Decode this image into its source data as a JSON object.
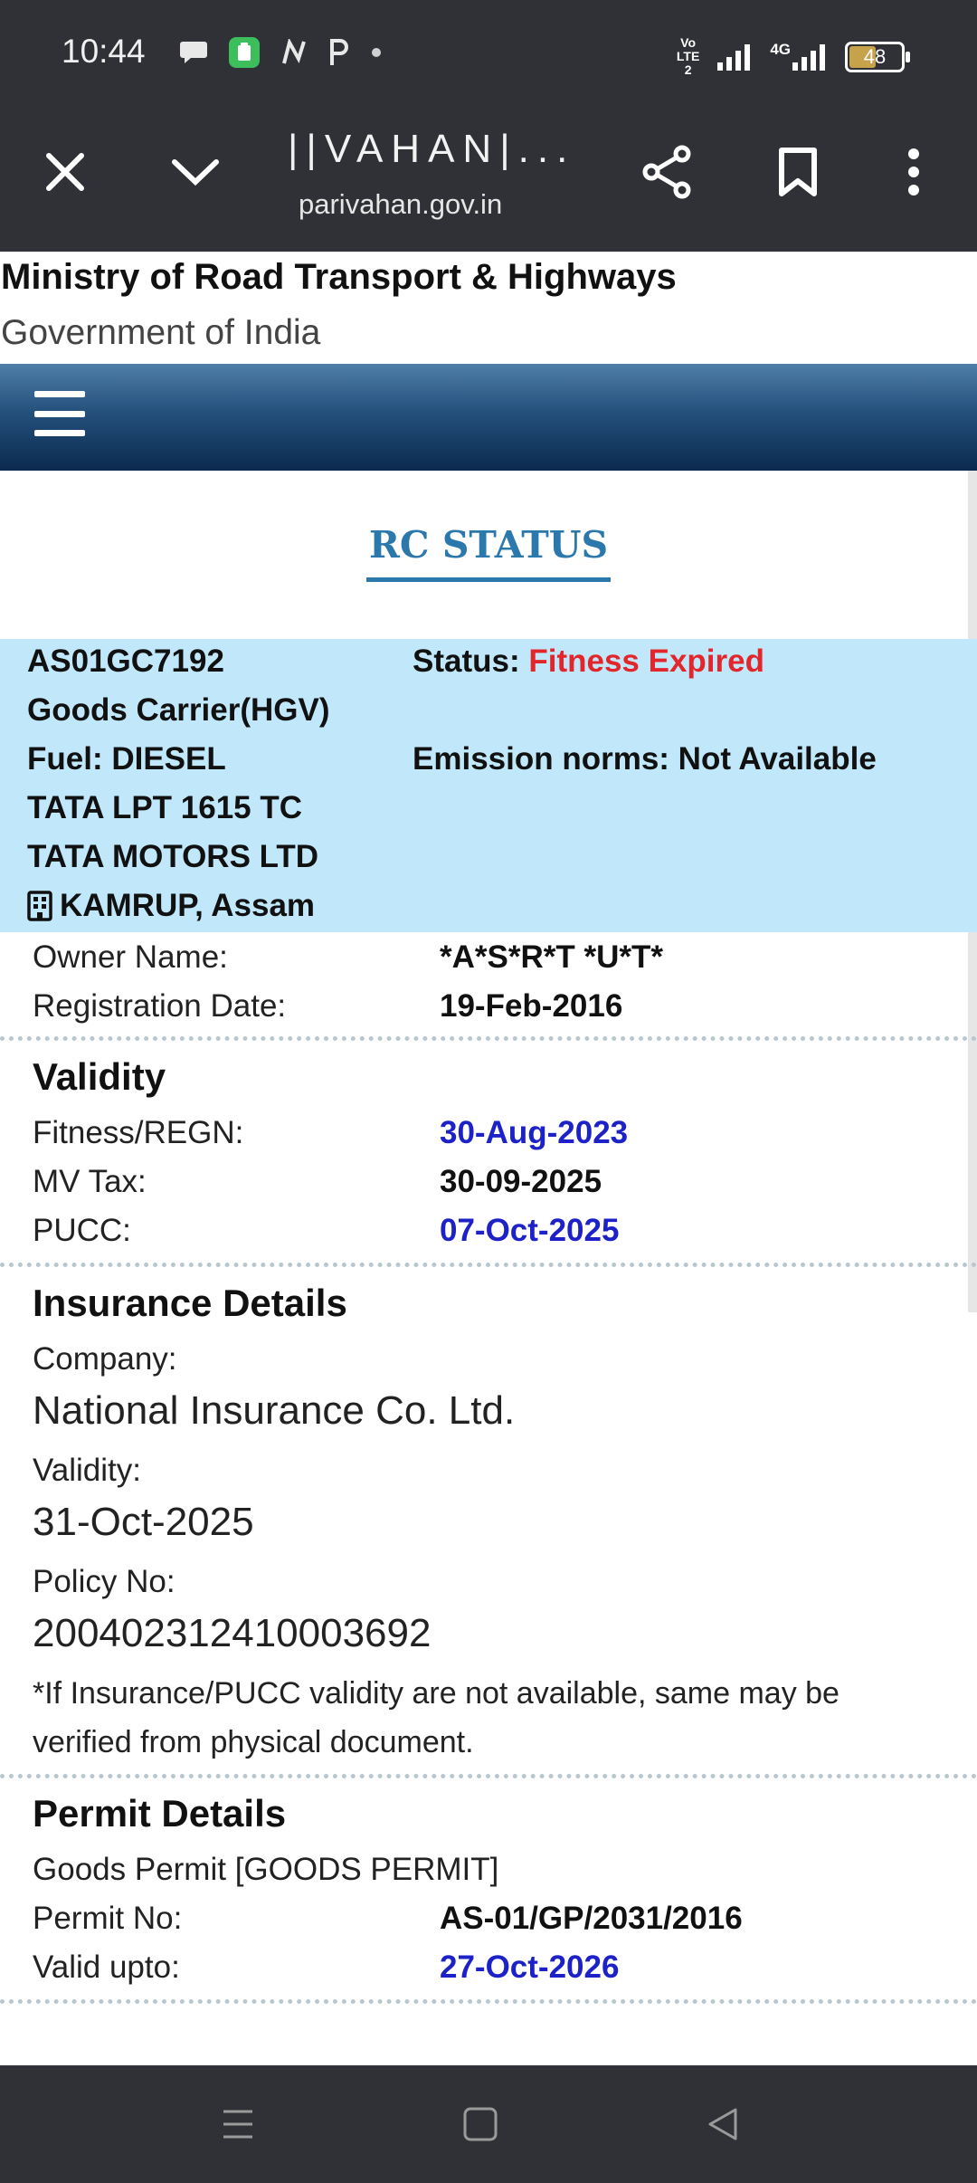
{
  "status_bar": {
    "time": "10:44",
    "net_label_top": "Vo",
    "net_label_mid": "LTE",
    "net_label_bot": "2",
    "net_type": "4G",
    "battery": "48",
    "notif_icons": [
      "chat-icon",
      "app-icon",
      "n-icon",
      "p-icon",
      "dot-icon"
    ]
  },
  "browser": {
    "title": "||VAHAN|...",
    "url": "parivahan.gov.in"
  },
  "header": {
    "ministry": "Ministry of Road Transport & Highways",
    "government": "Government of India"
  },
  "page_title": "RC STATUS",
  "vehicle": {
    "reg_no": "AS01GC7192",
    "status_label": "Status:",
    "status_value": "Fitness Expired",
    "class": "Goods Carrier(HGV)",
    "fuel": "Fuel: DIESEL",
    "emission": "Emission norms: Not Available",
    "model": "TATA LPT 1615 TC",
    "maker": "TATA MOTORS LTD",
    "rto": "KAMRUP, Assam"
  },
  "owner": {
    "owner_label": "Owner Name:",
    "owner_value": "*A*S*R*T *U*T*",
    "reg_date_label": "Registration Date:",
    "reg_date_value": "19-Feb-2016"
  },
  "validity": {
    "title": "Validity",
    "fitness_label": "Fitness/REGN:",
    "fitness_value": "30-Aug-2023",
    "mvtax_label": "MV Tax:",
    "mvtax_value": "30-09-2025",
    "pucc_label": "PUCC:",
    "pucc_value": "07-Oct-2025"
  },
  "insurance": {
    "title": "Insurance Details",
    "company_label": "Company:",
    "company_value": "National Insurance Co. Ltd.",
    "validity_label": "Validity:",
    "validity_value": "31-Oct-2025",
    "policy_label": "Policy No:",
    "policy_value": "200402312410003692",
    "note": "*If Insurance/PUCC validity are not available, same may be verified from physical document."
  },
  "permit": {
    "title": "Permit Details",
    "type": "Goods Permit [GOODS PERMIT]",
    "permit_no_label": "Permit No:",
    "permit_no_value": "AS-01/GP/2031/2016",
    "valid_label": "Valid upto:",
    "valid_value": "27-Oct-2026"
  },
  "colors": {
    "accent": "#2b78ad",
    "alert": "#e3262b",
    "date_blue": "#1c21c8",
    "highlight_bg": "#c0e8fa"
  }
}
